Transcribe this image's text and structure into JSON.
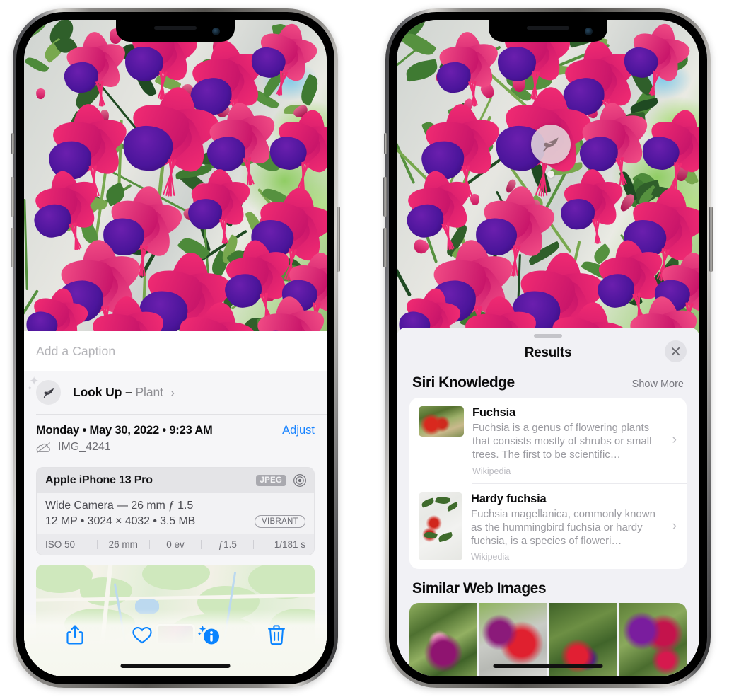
{
  "left_phone": {
    "caption": {
      "placeholder": "Add a Caption",
      "value": ""
    },
    "lookup": {
      "label": "Look Up",
      "dash": "–",
      "subject": "Plant",
      "chevron": "›",
      "icon": "leaf-icon"
    },
    "info": {
      "date": "Monday • May 30, 2022 • 9:23 AM",
      "adjust_label": "Adjust",
      "filename": "IMG_4241",
      "cloud_icon": "icloud-slash-icon"
    },
    "exif": {
      "device": "Apple iPhone 13 Pro",
      "format_badge": "JPEG",
      "aperture_icon": "aperture-icon",
      "lens_line": "Wide Camera — 26 mm ƒ 1.5",
      "size_line": "12 MP • 3024 × 4032 • 3.5 MB",
      "style_badge": "VIBRANT",
      "stats": [
        "ISO 50",
        "26 mm",
        "0 ev",
        "ƒ1.5",
        "1/181 s"
      ]
    },
    "map": {
      "pin_label": "photo-pin"
    },
    "toolbar": [
      {
        "name": "share-button",
        "icon": "share-icon"
      },
      {
        "name": "favorite-button",
        "icon": "heart-icon"
      },
      {
        "name": "info-button",
        "icon": "info-sparkle-icon"
      },
      {
        "name": "delete-button",
        "icon": "trash-icon"
      }
    ]
  },
  "right_phone": {
    "visual_lookup_badge": {
      "icon": "leaf-icon"
    },
    "sheet": {
      "title": "Results",
      "close_label": "✕",
      "sections": [
        {
          "title": "Siri Knowledge",
          "action": "Show More",
          "items": [
            {
              "title": "Fuchsia",
              "description": "Fuchsia is a genus of flowering plants that consists mostly of shrubs or small trees. The first to be scientific…",
              "source": "Wikipedia",
              "chevron": "›"
            },
            {
              "title": "Hardy fuchsia",
              "description": "Fuchsia magellanica, commonly known as the hummingbird fuchsia or hardy fuchsia, is a species of floweri…",
              "source": "Wikipedia",
              "chevron": "›"
            }
          ]
        },
        {
          "title": "Similar Web Images",
          "action": "",
          "thumbnails": [
            "web-image-1",
            "web-image-2",
            "web-image-3",
            "web-image-4"
          ]
        }
      ]
    }
  },
  "colors": {
    "accent_blue": "#1a84ff",
    "sheet_bg": "#f1f1f5",
    "card_bg": "#ffffff",
    "secondary_text": "#8e8e93",
    "tertiary_text": "#b8b8be"
  }
}
